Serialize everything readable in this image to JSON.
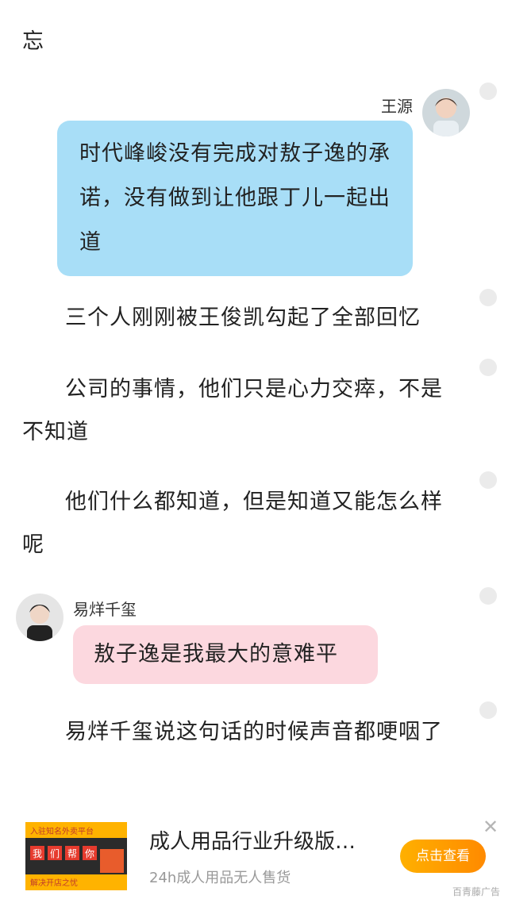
{
  "paragraphs": {
    "p0": "忘",
    "p1": "三个人刚刚被王俊凯勾起了全部回忆",
    "p2": "公司的事情，他们只是心力交瘁，不是不知道",
    "p3": "他们什么都知道，但是知道又能怎么样呢",
    "p4": "易烊千玺说这句话的时候声音都哽咽了"
  },
  "chat": {
    "msg1": {
      "speaker": "王源",
      "text": "时代峰峻没有完成对敖子逸的承诺，没有做到让他跟丁儿一起出道",
      "bubble_color": "#a8def7"
    },
    "msg2": {
      "speaker": "易烊千玺",
      "text": "敖子逸是我最大的意难平",
      "bubble_color": "#fcd8df"
    }
  },
  "ad": {
    "thumb_title": "入驻知名外卖平台",
    "thumb_chars": [
      "我",
      "们",
      "帮",
      "你"
    ],
    "thumb_footer": "解决开店之忧",
    "title": "成人用品行业升级版…",
    "subtitle": "24h成人用品无人售货",
    "button_label": "点击查看",
    "close_icon": "close-icon",
    "source": "百青藤广告",
    "accent_color": "#ff9a00"
  }
}
